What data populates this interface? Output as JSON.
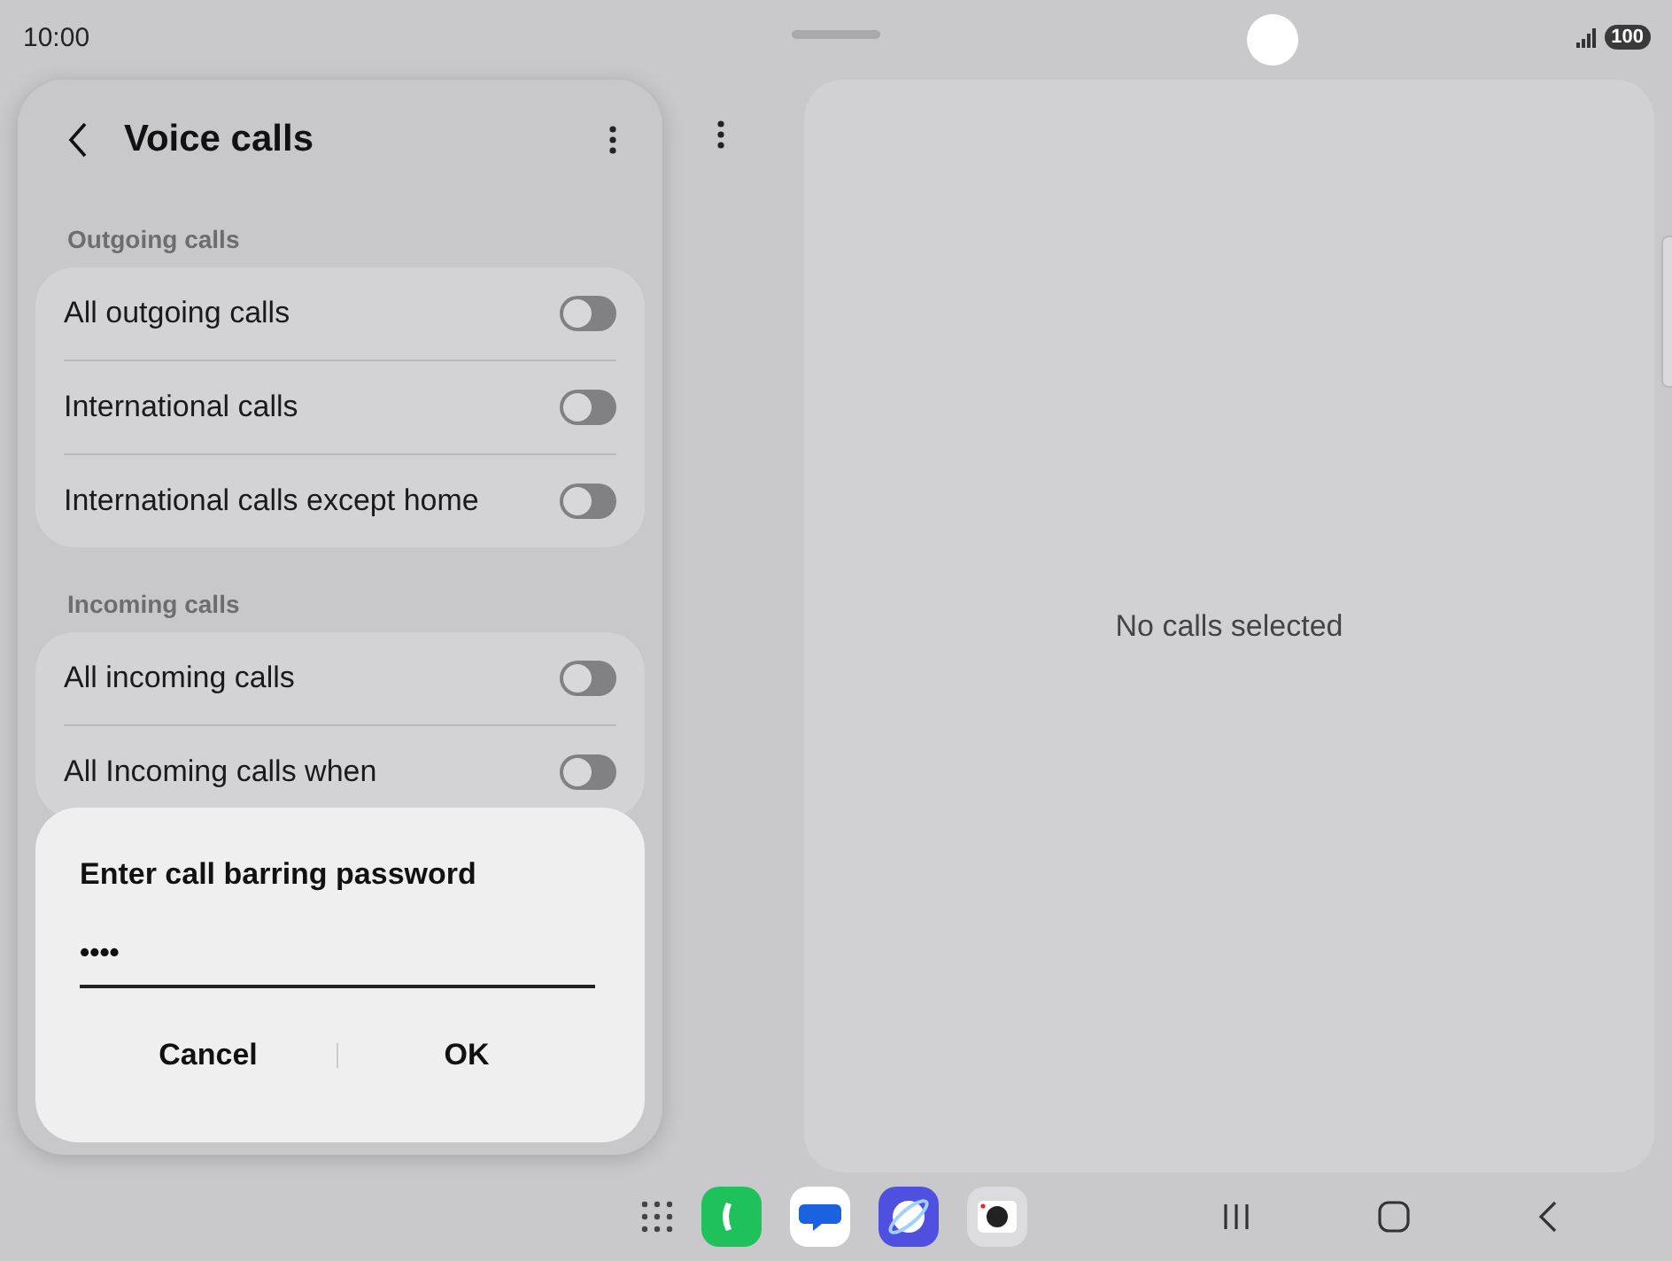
{
  "status_bar": {
    "time": "10:00",
    "battery": "100"
  },
  "settings_panel": {
    "title": "Voice calls",
    "sections": [
      {
        "header": "Outgoing calls",
        "items": [
          {
            "label": "All outgoing calls",
            "on": false
          },
          {
            "label": "International calls",
            "on": false
          },
          {
            "label": "International calls except home",
            "on": false
          }
        ]
      },
      {
        "header": "Incoming calls",
        "items": [
          {
            "label": "All incoming calls",
            "on": false
          },
          {
            "label": "All Incoming calls when",
            "on": false
          }
        ]
      }
    ]
  },
  "dialog": {
    "title": "Enter call barring password",
    "value": "••••",
    "buttons": [
      "Cancel",
      "OK"
    ]
  },
  "detail_panel": {
    "empty_message": "No calls selected"
  },
  "taskbar": {
    "apps": [
      {
        "kind": "phone"
      },
      {
        "kind": "messages"
      },
      {
        "kind": "browser"
      },
      {
        "kind": "camera"
      }
    ]
  }
}
